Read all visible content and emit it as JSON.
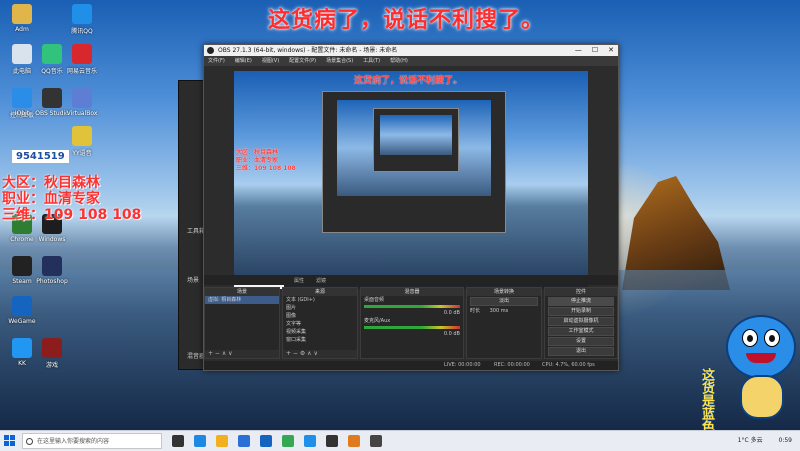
{
  "caption": "这货病了，说话不利搜了。",
  "desktop_icons": [
    {
      "label": "Adm",
      "color": "#e0b64a"
    },
    {
      "label": "此电脑",
      "color": "#d9e3ee"
    },
    {
      "label": "腾讯QQ",
      "color": "#1f8fe8"
    },
    {
      "label": "控制面板",
      "color": "#3a7bd5"
    },
    {
      "label": "QQ音乐",
      "color": "#31c27c"
    },
    {
      "label": "网易云音乐",
      "color": "#d8282e"
    },
    {
      "label": "IObit",
      "color": "#2a8ee8"
    },
    {
      "label": "OBS Studio",
      "color": "#333333"
    },
    {
      "label": "VirtualBox",
      "color": "#5e7ed6"
    },
    {
      "label": "YY语音",
      "color": "#e0c33a"
    },
    {
      "label": "Windows",
      "color": "#1d1d1d"
    },
    {
      "label": "Chrome",
      "color": "#2e7d32"
    },
    {
      "label": "Photoshop",
      "color": "#23305b"
    },
    {
      "label": "Steam",
      "color": "#222222"
    },
    {
      "label": "WeGame",
      "color": "#1565c0"
    },
    {
      "label": "KK",
      "color": "#2296f3"
    },
    {
      "label": "游戏",
      "color": "#8b1d1d"
    }
  ],
  "overlay_info": {
    "qq_number": "9541519",
    "lines": [
      "大区：秋目森林",
      "职业：血清专家",
      "三维：109 108 108"
    ]
  },
  "bg_window": {
    "labels": [
      "工具箱",
      "场景",
      "混音器"
    ]
  },
  "obs": {
    "title": "OBS 27.1.3 (64-bit, windows) - 配置文件: 未命名 - 场景: 未命名",
    "menus": [
      "文件(F)",
      "编辑(E)",
      "视图(V)",
      "配置文件(P)",
      "场景集合(S)",
      "工具(T)",
      "帮助(H)"
    ],
    "window_controls": [
      "—",
      "☐",
      "✕"
    ],
    "preview_caption": "这货病了，说话不利搜了。",
    "preview_info": [
      "大区：秋目森林",
      "职业：血清专家",
      "三维：109 108 108"
    ],
    "toolbar": {
      "properties": "属性",
      "filters": "滤镜"
    },
    "docks": {
      "scenes": {
        "title": "场景",
        "items": [
          "虚拟: 桐目森林"
        ],
        "selected": 0
      },
      "sources": {
        "title": "来源",
        "items": [
          "文本 (GDI+)",
          "图片",
          "图像",
          "文字等",
          "视频采集",
          "窗口采集"
        ]
      },
      "mixer": {
        "title": "混音器",
        "tracks": [
          {
            "name": "桌面音频",
            "db": "0.0 dB"
          },
          {
            "name": "麦克风/Aux",
            "db": "0.0 dB"
          }
        ]
      },
      "transitions": {
        "title": "场景转换",
        "type": "淡出",
        "duration_label": "时长",
        "duration": "300 ms"
      },
      "controls": {
        "title": "控件",
        "buttons": [
          "停止推流",
          "开始录制",
          "启动虚拟摄像机",
          "工作室模式",
          "设置",
          "退出"
        ]
      }
    },
    "status": {
      "live": "LIVE: 00:00:00",
      "rec": "REC: 00:00:00",
      "cpu": "CPU: 4.7%, 60.00 fps"
    }
  },
  "taskbar": {
    "search_placeholder": "在这里输入你要搜索的内容",
    "apps": [
      {
        "name": "task-view",
        "color": "#333333"
      },
      {
        "name": "edge",
        "color": "#1e88e5"
      },
      {
        "name": "explorer",
        "color": "#f2b01e"
      },
      {
        "name": "store",
        "color": "#2a6fd6"
      },
      {
        "name": "mail",
        "color": "#1565c0"
      },
      {
        "name": "chrome",
        "color": "#34a853"
      },
      {
        "name": "qq",
        "color": "#1f8fe8"
      },
      {
        "name": "obs-app",
        "color": "#333333"
      },
      {
        "name": "game",
        "color": "#e07a1f"
      },
      {
        "name": "obs-studio",
        "color": "#444444"
      }
    ],
    "weather": "1°C 多云",
    "time": "0:59"
  },
  "mascot_text": "这货是蓝色"
}
